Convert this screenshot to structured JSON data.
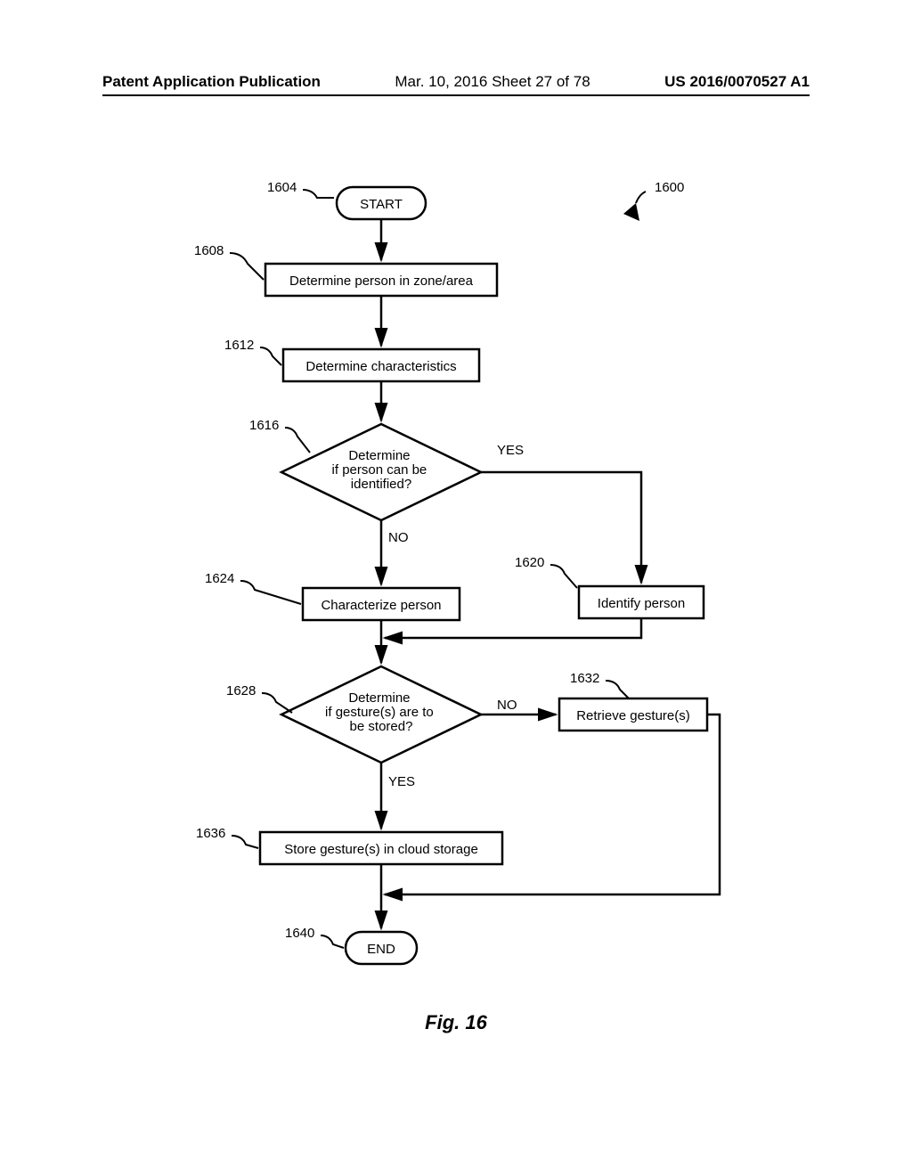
{
  "header": {
    "pub": "Patent Application Publication",
    "date": "Mar. 10, 2016  Sheet 27 of 78",
    "pubno": "US 2016/0070527 A1"
  },
  "figure_caption": "Fig. 16",
  "nodes": {
    "start": "START",
    "n1608": "Determine person in zone/area",
    "n1612": "Determine characteristics",
    "n1616": "Determine\nif person can be\nidentified?",
    "n1620": "Identify person",
    "n1624": "Characterize person",
    "n1628": "Determine\nif gesture(s) are to\nbe stored?",
    "n1632": "Retrieve gesture(s)",
    "n1636": "Store gesture(s) in cloud storage",
    "end": "END"
  },
  "refs": {
    "r1600": "1600",
    "r1604": "1604",
    "r1608": "1608",
    "r1612": "1612",
    "r1616": "1616",
    "r1620": "1620",
    "r1624": "1624",
    "r1628": "1628",
    "r1632": "1632",
    "r1636": "1636",
    "r1640": "1640"
  },
  "labels": {
    "yes": "YES",
    "no": "NO"
  }
}
